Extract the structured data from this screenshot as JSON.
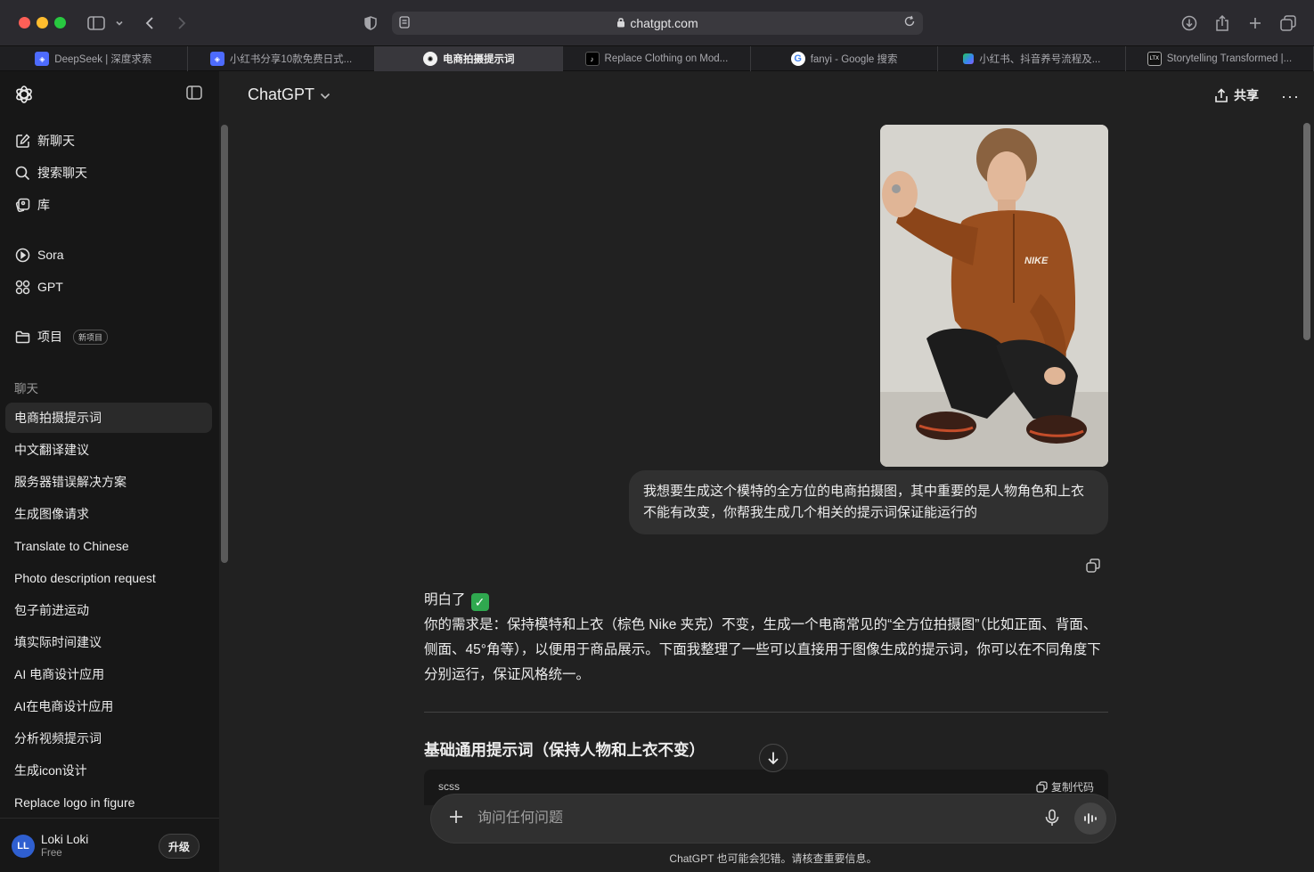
{
  "browser": {
    "url": "chatgpt.com",
    "tabs": [
      {
        "title": "DeepSeek | 深度求索",
        "favicon": "deepseek-icon",
        "favicon_color": "#4d6bfe"
      },
      {
        "title": "小红书分享10款免费日式...",
        "favicon": "deepseek-icon",
        "favicon_color": "#4d6bfe"
      },
      {
        "title": "电商拍摄提示词",
        "favicon": "chatgpt-icon",
        "favicon_color": "#ffffff",
        "active": true
      },
      {
        "title": "Replace Clothing on Mod...",
        "favicon": "tiktok-icon",
        "favicon_color": "#000000"
      },
      {
        "title": "fanyi - Google 搜索",
        "favicon": "google-icon",
        "favicon_color": "#4285f4"
      },
      {
        "title": "小红书、抖音养号流程及...",
        "favicon": "doc-icon",
        "favicon_color": "#3b82f6"
      },
      {
        "title": "Storytelling Transformed |...",
        "favicon": "ltx-icon",
        "favicon_color": "#111111"
      }
    ]
  },
  "sidebar": {
    "nav": [
      {
        "label": "新聊天",
        "icon": "new-chat-icon"
      },
      {
        "label": "搜索聊天",
        "icon": "search-icon"
      },
      {
        "label": "库",
        "icon": "library-icon"
      },
      {
        "label": "Sora",
        "icon": "sora-icon"
      },
      {
        "label": "GPT",
        "icon": "gpt-grid-icon"
      },
      {
        "label": "项目",
        "icon": "folder-icon",
        "badge": "新项目"
      }
    ],
    "section_label": "聊天",
    "chats": [
      "电商拍摄提示词",
      "中文翻译建议",
      "服务器错误解决方案",
      "生成图像请求",
      "Translate to Chinese",
      "Photo description request",
      "包子前进运动",
      "填实际时间建议",
      "AI 电商设计应用",
      "AI在电商设计应用",
      "分析视频提示词",
      "生成icon设计",
      "Replace logo in figure"
    ],
    "active_chat": 0,
    "user": {
      "initials": "LL",
      "name": "Loki Loki",
      "plan": "Free",
      "upgrade_label": "升级"
    }
  },
  "header": {
    "model": "ChatGPT",
    "share_label": "共享",
    "more_label": "···"
  },
  "conversation": {
    "user_message": "我想要生成这个模特的全方位的电商拍摄图，其中重要的是人物角色和上衣不能有改变，你帮我生成几个相关的提示词保证能运行的",
    "assistant_intro": "明白了",
    "assistant_check": "✓",
    "assistant_body": "你的需求是：保持模特和上衣（棕色 Nike 夹克）不变，生成一个电商常见的“全方位拍摄图”（比如正面、背面、侧面、45°角等），以便用于商品展示。下面我整理了一些可以直接用于图像生成的提示词，你可以在不同角度下分别运行，保证风格统一。",
    "section_title": "基础通用提示词（保持人物和上衣不变）",
    "code_lang": "scss",
    "code_copy_label": "复制代码"
  },
  "composer": {
    "placeholder": "询问任何问题"
  },
  "footer": {
    "disclaimer": "ChatGPT 也可能会犯错。请核查重要信息。"
  },
  "colors": {
    "bg_main": "#212121",
    "bg_sidebar": "#171717",
    "bubble": "#303030",
    "accent_check": "#2fa84f"
  }
}
